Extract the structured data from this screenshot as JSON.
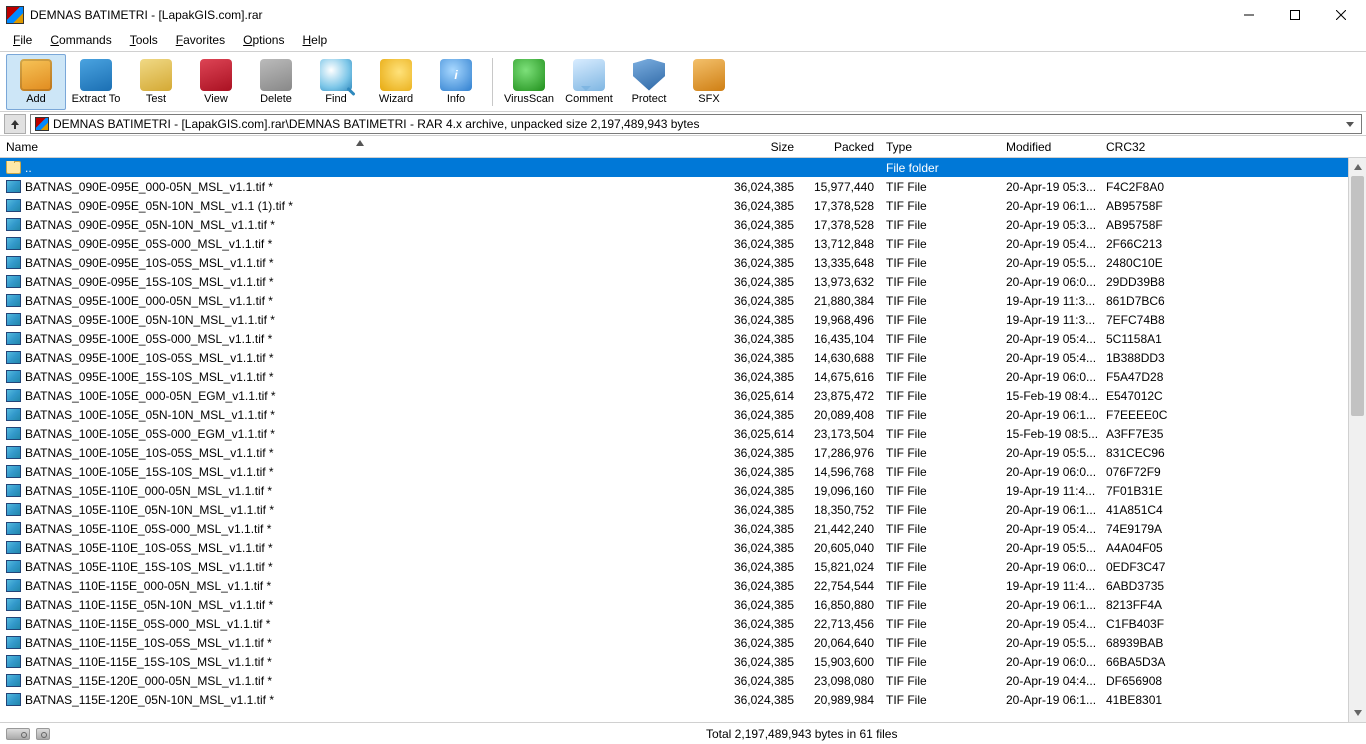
{
  "title": "DEMNAS BATIMETRI - [LapakGIS.com].rar",
  "menu": [
    "File",
    "Commands",
    "Tools",
    "Favorites",
    "Options",
    "Help"
  ],
  "toolbar": [
    {
      "id": "add",
      "label": "Add",
      "icon": "ic-add",
      "selected": true
    },
    {
      "id": "extract",
      "label": "Extract To",
      "icon": "ic-extract"
    },
    {
      "id": "test",
      "label": "Test",
      "icon": "ic-test"
    },
    {
      "id": "view",
      "label": "View",
      "icon": "ic-view"
    },
    {
      "id": "delete",
      "label": "Delete",
      "icon": "ic-delete"
    },
    {
      "id": "find",
      "label": "Find",
      "icon": "ic-find"
    },
    {
      "id": "wizard",
      "label": "Wizard",
      "icon": "ic-wizard"
    },
    {
      "id": "info",
      "label": "Info",
      "icon": "ic-info"
    },
    {
      "sep": true
    },
    {
      "id": "virus",
      "label": "VirusScan",
      "icon": "ic-virus"
    },
    {
      "id": "comment",
      "label": "Comment",
      "icon": "ic-comment"
    },
    {
      "id": "protect",
      "label": "Protect",
      "icon": "ic-protect"
    },
    {
      "id": "sfx",
      "label": "SFX",
      "icon": "ic-sfx"
    }
  ],
  "address": "DEMNAS BATIMETRI - [LapakGIS.com].rar\\DEMNAS BATIMETRI - RAR 4.x archive, unpacked size 2,197,489,943 bytes",
  "columns": [
    "Name",
    "Size",
    "Packed",
    "Type",
    "Modified",
    "CRC32"
  ],
  "updir": {
    "name": "..",
    "type": "File folder"
  },
  "rows": [
    {
      "name": "BATNAS_090E-095E_000-05N_MSL_v1.1.tif *",
      "size": "36,024,385",
      "packed": "15,977,440",
      "type": "TIF File",
      "mod": "20-Apr-19 05:3...",
      "crc": "F4C2F8A0"
    },
    {
      "name": "BATNAS_090E-095E_05N-10N_MSL_v1.1 (1).tif *",
      "size": "36,024,385",
      "packed": "17,378,528",
      "type": "TIF File",
      "mod": "20-Apr-19 06:1...",
      "crc": "AB95758F"
    },
    {
      "name": "BATNAS_090E-095E_05N-10N_MSL_v1.1.tif *",
      "size": "36,024,385",
      "packed": "17,378,528",
      "type": "TIF File",
      "mod": "20-Apr-19 05:3...",
      "crc": "AB95758F"
    },
    {
      "name": "BATNAS_090E-095E_05S-000_MSL_v1.1.tif *",
      "size": "36,024,385",
      "packed": "13,712,848",
      "type": "TIF File",
      "mod": "20-Apr-19 05:4...",
      "crc": "2F66C213"
    },
    {
      "name": "BATNAS_090E-095E_10S-05S_MSL_v1.1.tif *",
      "size": "36,024,385",
      "packed": "13,335,648",
      "type": "TIF File",
      "mod": "20-Apr-19 05:5...",
      "crc": "2480C10E"
    },
    {
      "name": "BATNAS_090E-095E_15S-10S_MSL_v1.1.tif *",
      "size": "36,024,385",
      "packed": "13,973,632",
      "type": "TIF File",
      "mod": "20-Apr-19 06:0...",
      "crc": "29DD39B8"
    },
    {
      "name": "BATNAS_095E-100E_000-05N_MSL_v1.1.tif *",
      "size": "36,024,385",
      "packed": "21,880,384",
      "type": "TIF File",
      "mod": "19-Apr-19 11:3...",
      "crc": "861D7BC6"
    },
    {
      "name": "BATNAS_095E-100E_05N-10N_MSL_v1.1.tif *",
      "size": "36,024,385",
      "packed": "19,968,496",
      "type": "TIF File",
      "mod": "19-Apr-19 11:3...",
      "crc": "7EFC74B8"
    },
    {
      "name": "BATNAS_095E-100E_05S-000_MSL_v1.1.tif *",
      "size": "36,024,385",
      "packed": "16,435,104",
      "type": "TIF File",
      "mod": "20-Apr-19 05:4...",
      "crc": "5C1158A1"
    },
    {
      "name": "BATNAS_095E-100E_10S-05S_MSL_v1.1.tif *",
      "size": "36,024,385",
      "packed": "14,630,688",
      "type": "TIF File",
      "mod": "20-Apr-19 05:4...",
      "crc": "1B388DD3"
    },
    {
      "name": "BATNAS_095E-100E_15S-10S_MSL_v1.1.tif *",
      "size": "36,024,385",
      "packed": "14,675,616",
      "type": "TIF File",
      "mod": "20-Apr-19 06:0...",
      "crc": "F5A47D28"
    },
    {
      "name": "BATNAS_100E-105E_000-05N_EGM_v1.1.tif *",
      "size": "36,025,614",
      "packed": "23,875,472",
      "type": "TIF File",
      "mod": "15-Feb-19 08:4...",
      "crc": "E547012C"
    },
    {
      "name": "BATNAS_100E-105E_05N-10N_MSL_v1.1.tif *",
      "size": "36,024,385",
      "packed": "20,089,408",
      "type": "TIF File",
      "mod": "20-Apr-19 06:1...",
      "crc": "F7EEEE0C"
    },
    {
      "name": "BATNAS_100E-105E_05S-000_EGM_v1.1.tif *",
      "size": "36,025,614",
      "packed": "23,173,504",
      "type": "TIF File",
      "mod": "15-Feb-19 08:5...",
      "crc": "A3FF7E35"
    },
    {
      "name": "BATNAS_100E-105E_10S-05S_MSL_v1.1.tif *",
      "size": "36,024,385",
      "packed": "17,286,976",
      "type": "TIF File",
      "mod": "20-Apr-19 05:5...",
      "crc": "831CEC96"
    },
    {
      "name": "BATNAS_100E-105E_15S-10S_MSL_v1.1.tif *",
      "size": "36,024,385",
      "packed": "14,596,768",
      "type": "TIF File",
      "mod": "20-Apr-19 06:0...",
      "crc": "076F72F9"
    },
    {
      "name": "BATNAS_105E-110E_000-05N_MSL_v1.1.tif *",
      "size": "36,024,385",
      "packed": "19,096,160",
      "type": "TIF File",
      "mod": "19-Apr-19 11:4...",
      "crc": "7F01B31E"
    },
    {
      "name": "BATNAS_105E-110E_05N-10N_MSL_v1.1.tif *",
      "size": "36,024,385",
      "packed": "18,350,752",
      "type": "TIF File",
      "mod": "20-Apr-19 06:1...",
      "crc": "41A851C4"
    },
    {
      "name": "BATNAS_105E-110E_05S-000_MSL_v1.1.tif *",
      "size": "36,024,385",
      "packed": "21,442,240",
      "type": "TIF File",
      "mod": "20-Apr-19 05:4...",
      "crc": "74E9179A"
    },
    {
      "name": "BATNAS_105E-110E_10S-05S_MSL_v1.1.tif *",
      "size": "36,024,385",
      "packed": "20,605,040",
      "type": "TIF File",
      "mod": "20-Apr-19 05:5...",
      "crc": "A4A04F05"
    },
    {
      "name": "BATNAS_105E-110E_15S-10S_MSL_v1.1.tif *",
      "size": "36,024,385",
      "packed": "15,821,024",
      "type": "TIF File",
      "mod": "20-Apr-19 06:0...",
      "crc": "0EDF3C47"
    },
    {
      "name": "BATNAS_110E-115E_000-05N_MSL_v1.1.tif *",
      "size": "36,024,385",
      "packed": "22,754,544",
      "type": "TIF File",
      "mod": "19-Apr-19 11:4...",
      "crc": "6ABD3735"
    },
    {
      "name": "BATNAS_110E-115E_05N-10N_MSL_v1.1.tif *",
      "size": "36,024,385",
      "packed": "16,850,880",
      "type": "TIF File",
      "mod": "20-Apr-19 06:1...",
      "crc": "8213FF4A"
    },
    {
      "name": "BATNAS_110E-115E_05S-000_MSL_v1.1.tif *",
      "size": "36,024,385",
      "packed": "22,713,456",
      "type": "TIF File",
      "mod": "20-Apr-19 05:4...",
      "crc": "C1FB403F"
    },
    {
      "name": "BATNAS_110E-115E_10S-05S_MSL_v1.1.tif *",
      "size": "36,024,385",
      "packed": "20,064,640",
      "type": "TIF File",
      "mod": "20-Apr-19 05:5...",
      "crc": "68939BAB"
    },
    {
      "name": "BATNAS_110E-115E_15S-10S_MSL_v1.1.tif *",
      "size": "36,024,385",
      "packed": "15,903,600",
      "type": "TIF File",
      "mod": "20-Apr-19 06:0...",
      "crc": "66BA5D3A"
    },
    {
      "name": "BATNAS_115E-120E_000-05N_MSL_v1.1.tif *",
      "size": "36,024,385",
      "packed": "23,098,080",
      "type": "TIF File",
      "mod": "20-Apr-19 04:4...",
      "crc": "DF656908"
    },
    {
      "name": "BATNAS_115E-120E_05N-10N_MSL_v1.1.tif *",
      "size": "36,024,385",
      "packed": "20,989,984",
      "type": "TIF File",
      "mod": "20-Apr-19 06:1...",
      "crc": "41BE8301"
    }
  ],
  "status": "Total 2,197,489,943 bytes in 61 files"
}
